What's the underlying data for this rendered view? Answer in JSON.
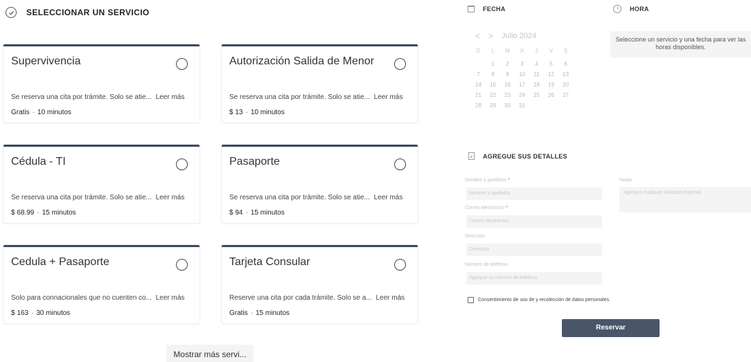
{
  "services": {
    "title": "SELECCIONAR UN SERVICIO",
    "cards": [
      {
        "name": "Supervivencia",
        "desc": "Se reserva una cita por trámite. Solo se atie...",
        "more": "Leer más",
        "price": "Gratis",
        "duration": "10 minutos"
      },
      {
        "name": "Autorización Salida de Menor",
        "desc": "Se reserva una cita por trámite. Solo se atie...",
        "more": "Leer más",
        "price": "$ 13",
        "duration": "10 minutos"
      },
      {
        "name": "Cédula - TI",
        "desc": "Se reserva una cita por trámite. Solo se atie...",
        "more": "Leer más",
        "price": "$ 68.99",
        "duration": "15 minutos"
      },
      {
        "name": "Pasaporte",
        "desc": "Se reserva una cita por trámite. Solo se atie...",
        "more": "Leer más",
        "price": "$ 94",
        "duration": "15 minutos"
      },
      {
        "name": "Cedula + Pasaporte",
        "desc": "Solo para connacionales que no cuenten co...",
        "more": "Leer más",
        "price": "$ 163",
        "duration": "30 minutos"
      },
      {
        "name": "Tarjeta Consular",
        "desc": "Reserve una cita por cada trámite. Solo se a...",
        "more": "Leer más",
        "price": "Gratis",
        "duration": "15 minutos"
      }
    ],
    "separator": "·",
    "show_more": "Mostrar más servi..."
  },
  "date": {
    "title": "FECHA",
    "prev": "<",
    "next": ">",
    "month": "Julio 2024",
    "weekdays": [
      "D",
      "L",
      "M",
      "X",
      "J",
      "V",
      "S"
    ],
    "weeks": [
      [
        "",
        "1",
        "2",
        "3",
        "4",
        "5",
        "6"
      ],
      [
        "7",
        "8",
        "9",
        "10",
        "11",
        "12",
        "13"
      ],
      [
        "14",
        "15",
        "16",
        "17",
        "18",
        "19",
        "20"
      ],
      [
        "21",
        "22",
        "23",
        "24",
        "25",
        "26",
        "27"
      ],
      [
        "28",
        "29",
        "30",
        "31",
        "",
        "",
        ""
      ]
    ]
  },
  "time": {
    "title": "HORA",
    "message": "Seleccione un servicio y una fecha para ver las horas disponibles."
  },
  "details": {
    "title": "AGREGUE SUS DETALLES",
    "name_label": "Nombre y apellidos",
    "name_placeholder": "Nombre y apellidos",
    "email_label": "Correo electrónico",
    "email_placeholder": "Correo electrónico",
    "address_label": "Dirección",
    "address_placeholder": "Dirección",
    "phone_label": "Número de teléfono",
    "phone_placeholder": "Agregue su número de teléfono",
    "notes_label": "Notas",
    "notes_placeholder": "Agregue cualquier solicitud especial",
    "required_mark": "*",
    "consent": "Consentimiento de uso de y recolección de datos personales.",
    "submit": "Reservar"
  }
}
